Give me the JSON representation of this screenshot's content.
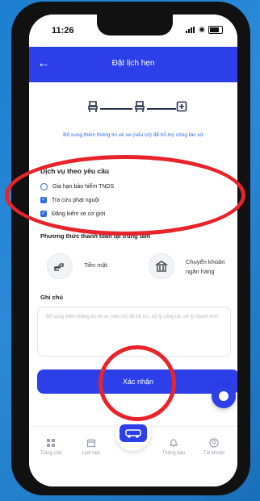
{
  "status_bar": {
    "time": "11:26"
  },
  "header": {
    "title": "Đặt lịch hẹn",
    "back_icon": "arrow-left-icon"
  },
  "stepper": {
    "active_color": "#25324e"
  },
  "hint": "Bổ sung thêm thông tin về xe (nếu có) để hỗ trợ công tác xử",
  "services": {
    "title": "Dịch vụ theo yêu cầu",
    "items": [
      {
        "label": "Gia hạn bảo hiểm TNDS",
        "checked": false
      },
      {
        "label": "Tra cứu phạt nguội",
        "checked": true
      },
      {
        "label": "Đăng kiểm xe cơ giới",
        "checked": true
      }
    ]
  },
  "payment": {
    "title": "Phương thức thanh toán tại trung tâm",
    "cash_label": "Tiền mặt",
    "transfer_label_1": "Chuyển khoản",
    "transfer_label_2": "ngân hàng"
  },
  "notes": {
    "title": "Ghi chú",
    "placeholder": "Bổ sung thêm thông tin về xe (nếu có) để hỗ trợ, xử lý công tác xử lý nhanh hơn"
  },
  "confirm_label": "Xác nhận",
  "tabs": [
    {
      "label": "Trang chủ",
      "icon": "grid-icon"
    },
    {
      "label": "Lịch hẹn",
      "icon": "calendar-icon"
    },
    {
      "label": "Thông báo",
      "icon": "bell-icon"
    },
    {
      "label": "Tài khoản",
      "icon": "user-icon"
    }
  ],
  "colors": {
    "primary": "#2c3fe8",
    "highlight_ring": "#e8232a",
    "link": "#2c6ae8"
  }
}
